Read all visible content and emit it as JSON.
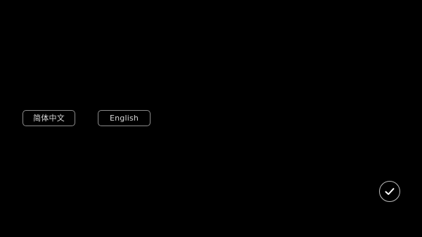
{
  "language_selector": {
    "options": [
      {
        "label": "简体中文"
      },
      {
        "label": "English"
      }
    ]
  },
  "confirm": {
    "icon": "checkmark-icon"
  },
  "colors": {
    "background": "#000000",
    "button_border": "#8a8a8a",
    "button_text": "#d8d8d8",
    "confirm_border": "#bdbdbd",
    "confirm_check": "#ffffff"
  }
}
